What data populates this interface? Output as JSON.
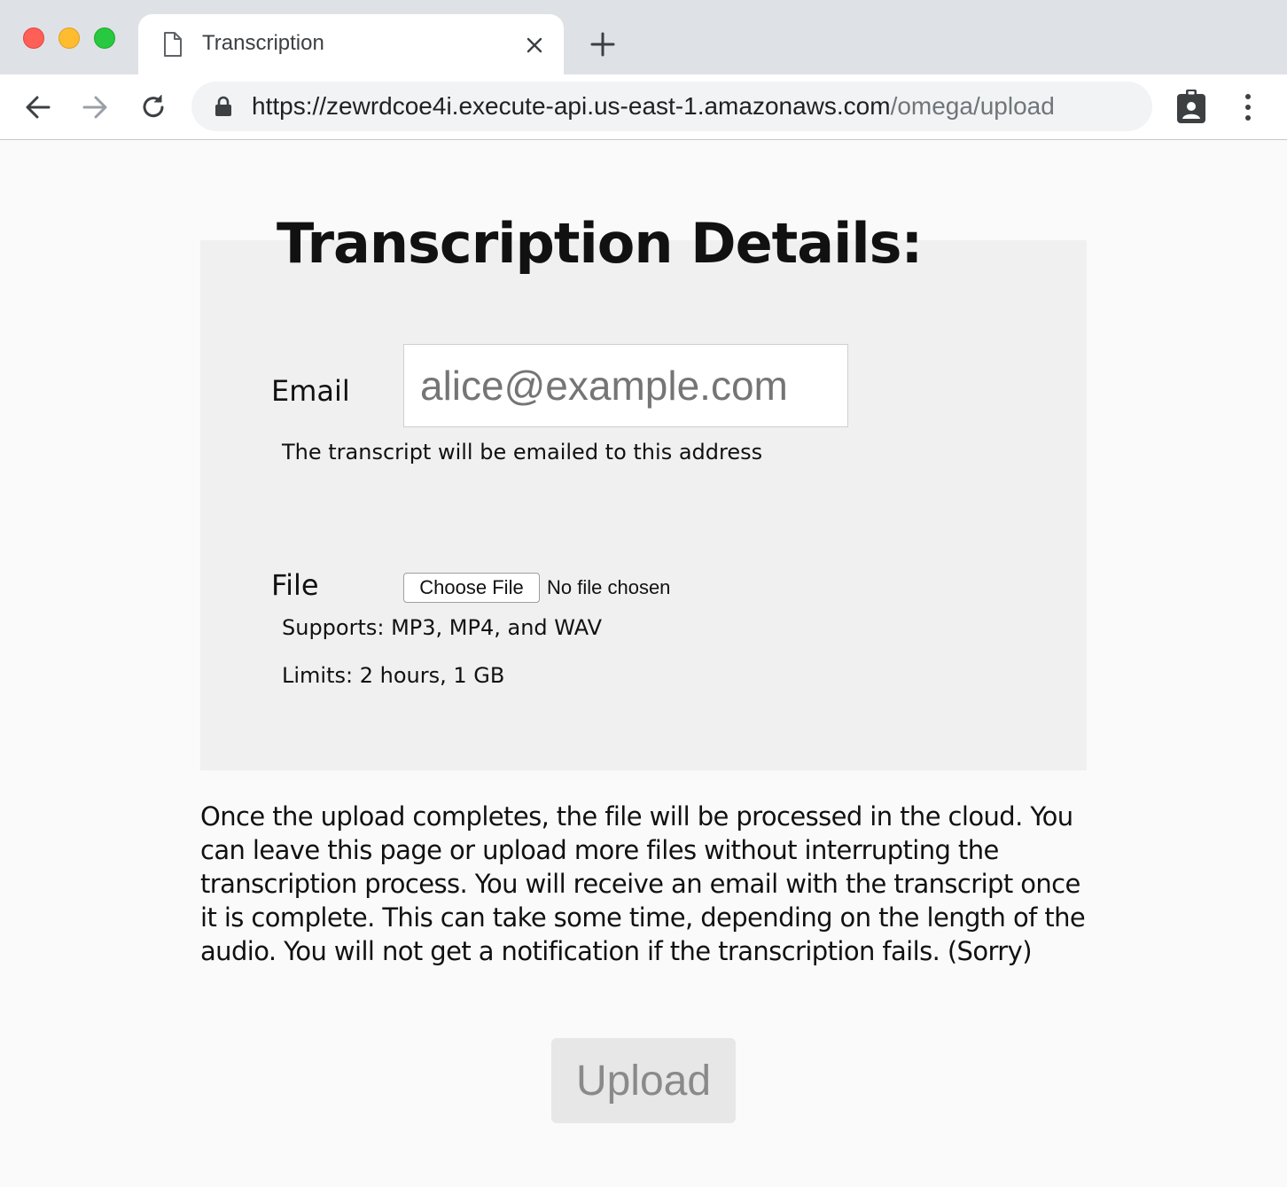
{
  "window": {
    "buttons": {
      "close_color": "#fe5f57",
      "minimize_color": "#febc2e",
      "maximize_color": "#28c840"
    }
  },
  "tab": {
    "title": "Transcription",
    "icon": "document-icon",
    "close_icon": "close-icon"
  },
  "new_tab_icon": "plus-icon",
  "toolbar": {
    "back_icon": "back-arrow-icon",
    "forward_icon": "forward-arrow-icon",
    "reload_icon": "reload-icon",
    "url_host": "https://zewrdcoe4i.execute-api.us-east-1.amazonaws.com",
    "url_path": "/omega/upload",
    "lock_icon": "lock-icon",
    "profile_icon": "badge-icon",
    "menu_icon": "kebab-menu-icon"
  },
  "form": {
    "heading": "Transcription Details:",
    "email": {
      "label": "Email",
      "placeholder": "alice@example.com",
      "value": "",
      "hint": "The transcript will be emailed to this address"
    },
    "file": {
      "label": "File",
      "button_label": "Choose File",
      "status": "No file chosen",
      "supports": "Supports: MP3, MP4, and WAV",
      "limits": "Limits: 2 hours, 1 GB"
    }
  },
  "info_text": "Once the upload completes, the file will be processed in the cloud. You can leave this page or upload more files without interrupting the transcription process. You will receive an email with the transcript once it is complete. This can take some time, depending on the length of the audio. You will not get a notification if the transcription fails. (Sorry)",
  "upload_label": "Upload",
  "colors": {
    "panel_bg": "#f0f0f0",
    "page_bg": "#fafafa",
    "tabbar_bg": "#dee1e6"
  }
}
